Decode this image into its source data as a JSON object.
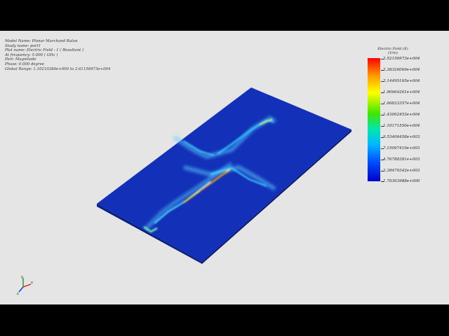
{
  "info": {
    "lines": [
      "Model Name: Planar Marchand Balun",
      "Study name: port1",
      "Plot name: Electric Field - 1 ( Resultant )",
      "At frequency: 5.000 ( GHz )",
      "Part: Magnitude",
      "Phase: 0.000 degree",
      "Global Range: 1.10210286e+000 to 2.61156973e+004"
    ]
  },
  "legend": {
    "title_line1": "Electric Field (E)",
    "title_line2": "(V/m)",
    "labels": [
      "2.52156973e+004",
      "2.38326069e+004",
      "2.14495165e+004",
      "1.90664261e+004",
      "1.66833357e+004",
      "1.43002453e+004",
      "1.19171550e+004",
      "9.53406458e+003",
      "7.15097419e+003",
      "4.76788381e+003",
      "2.38479342e+003",
      "1.70303988e+000"
    ]
  },
  "triad": {
    "x_label": "x",
    "y_label": "y",
    "z_label": "z"
  },
  "colors": {
    "plate": "#1230b8",
    "plate_edge": "#0b1f82",
    "background": "#e5e5e5",
    "frame": "#000000"
  }
}
